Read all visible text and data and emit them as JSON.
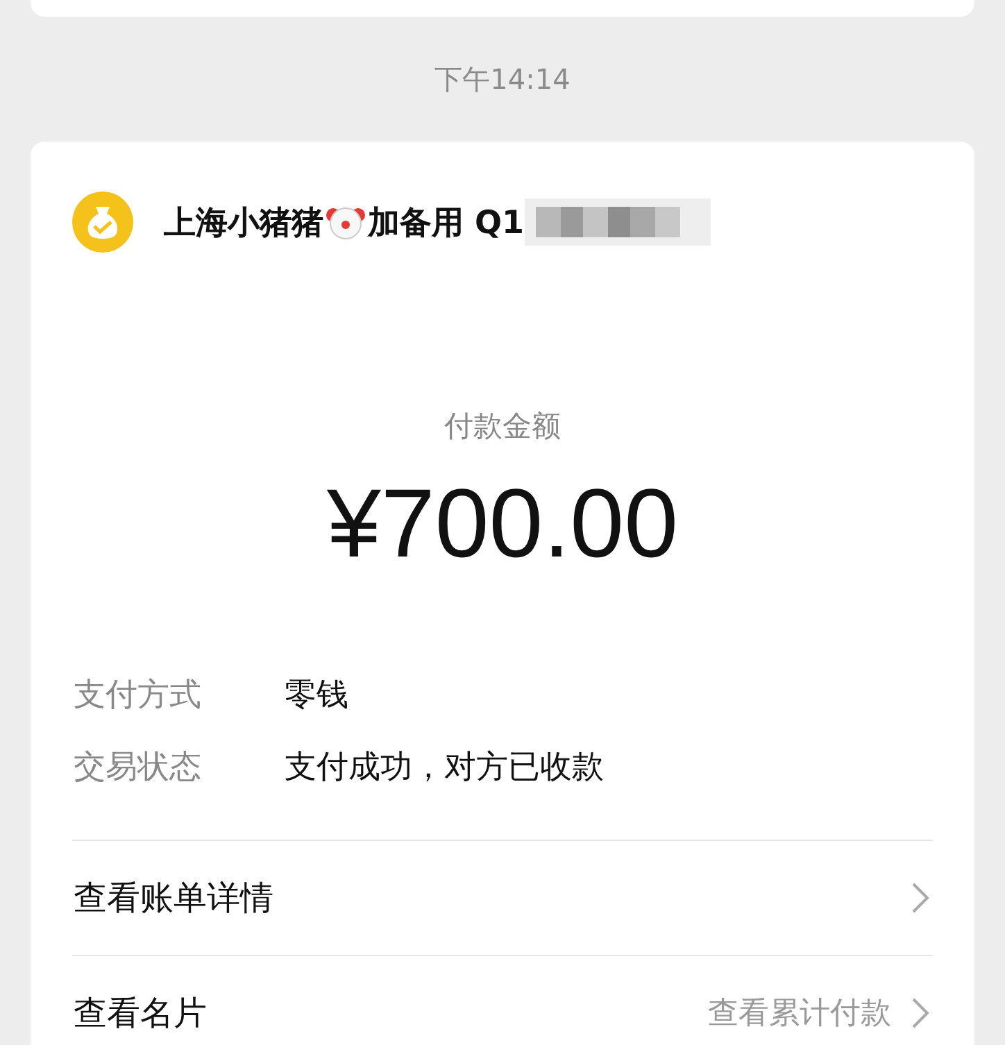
{
  "time": "下午14:14",
  "card": {
    "sender_name_start": "上海小猪猪",
    "sender_name_end": "加备用 Q1",
    "sender_name_redacted": true,
    "amount_label": "付款金额",
    "amount": "¥700.00",
    "details": [
      {
        "label": "支付方式",
        "value": "零钱"
      },
      {
        "label": "交易状态",
        "value": "支付成功，对方已收款"
      }
    ],
    "links": [
      {
        "label": "查看账单详情"
      },
      {
        "label": "查看名片",
        "secondary": "查看累计付款"
      }
    ]
  }
}
